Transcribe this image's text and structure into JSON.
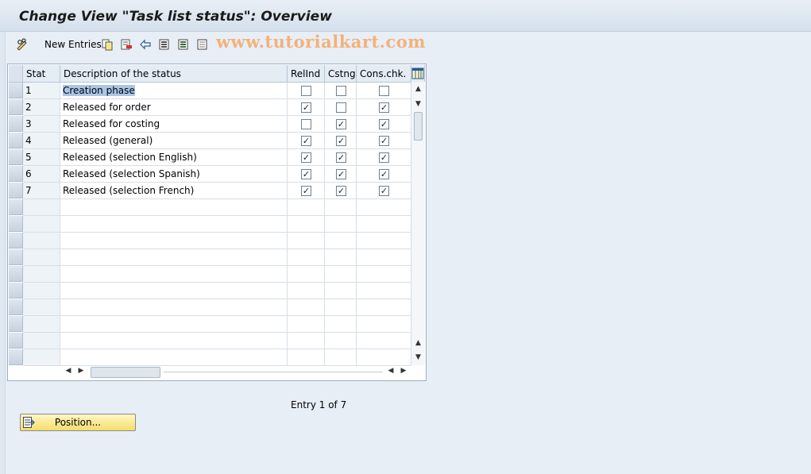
{
  "window": {
    "title": "Change View \"Task list status\": Overview"
  },
  "toolbar": {
    "new_entries_label": "New Entries",
    "icons": [
      "pencil-glasses-icon",
      "copy-icon",
      "delete-icon",
      "undo-icon",
      "select-all-icon",
      "select-block-icon",
      "deselect-all-icon"
    ]
  },
  "watermark": "www.tutorialkart.com",
  "table": {
    "columns": [
      "Stat",
      "Description of the status",
      "RelInd",
      "Cstng",
      "Cons.chk."
    ],
    "rows": [
      {
        "stat": "1",
        "description": "Creation phase",
        "relind": false,
        "cstng": false,
        "conschk": false
      },
      {
        "stat": "2",
        "description": "Released for order",
        "relind": true,
        "cstng": false,
        "conschk": true
      },
      {
        "stat": "3",
        "description": "Released for costing",
        "relind": false,
        "cstng": true,
        "conschk": true
      },
      {
        "stat": "4",
        "description": "Released (general)",
        "relind": true,
        "cstng": true,
        "conschk": true
      },
      {
        "stat": "5",
        "description": "Released (selection English)",
        "relind": true,
        "cstng": true,
        "conschk": true
      },
      {
        "stat": "6",
        "description": "Released (selection Spanish)",
        "relind": true,
        "cstng": true,
        "conschk": true
      },
      {
        "stat": "7",
        "description": "Released (selection French)",
        "relind": true,
        "cstng": true,
        "conschk": true
      }
    ],
    "empty_rows": 10
  },
  "status": {
    "entry_text": "Entry 1 of 7"
  },
  "position_button": {
    "label": "Position..."
  },
  "colors": {
    "accent_button": "#f6dd6a",
    "selection": "#a9c6e6"
  }
}
